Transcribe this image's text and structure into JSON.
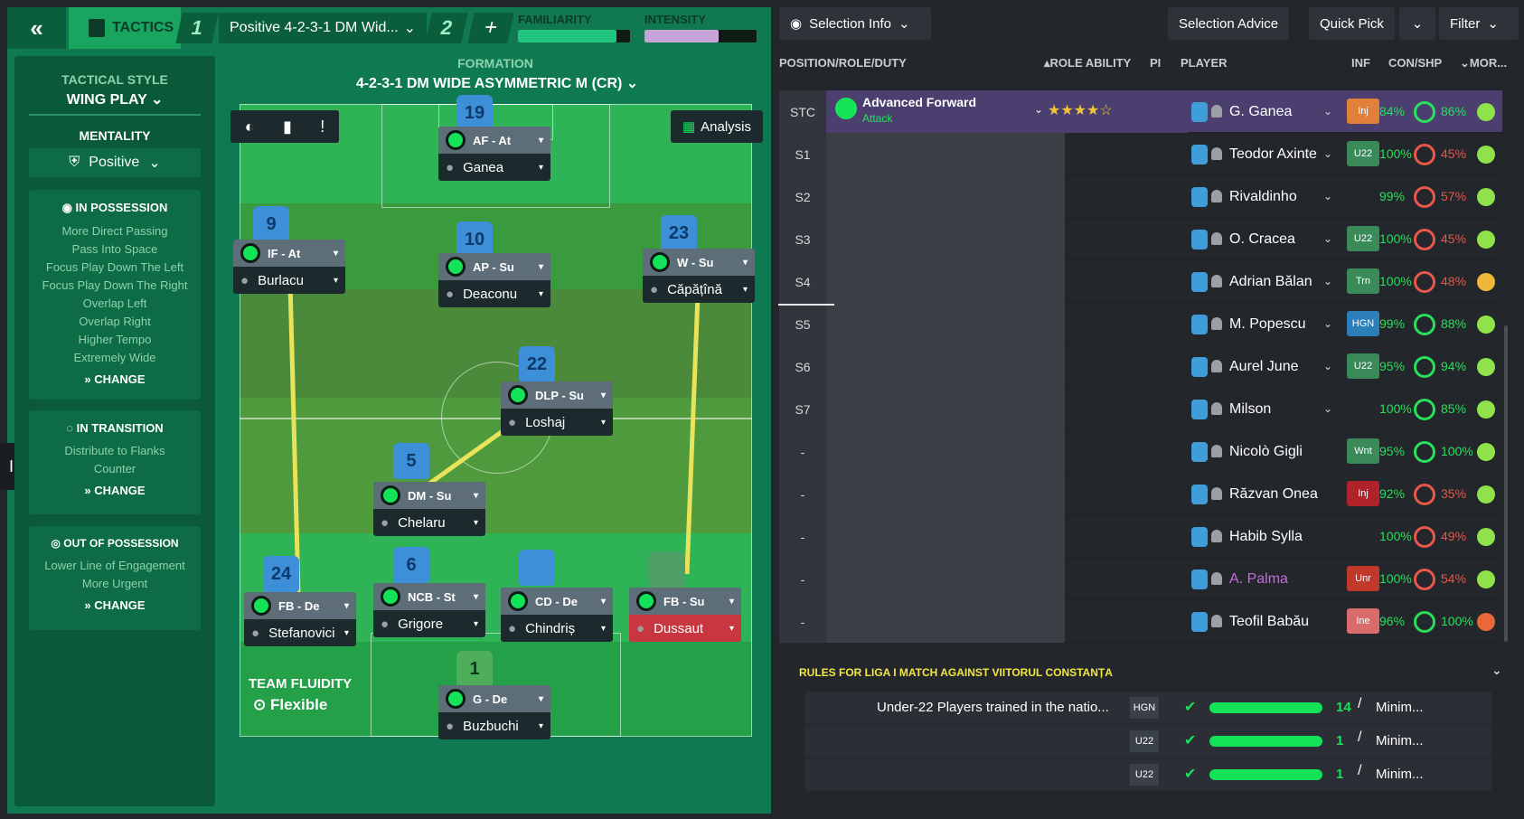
{
  "topbar": {
    "back": "«",
    "tactics_label": "TACTICS",
    "tactic1": "1",
    "tactic_name": "Positive 4-2-3-1 DM Wid...",
    "tactic2": "2",
    "plus": "+",
    "familiarity_label": "FAMILIARITY",
    "intensity_label": "INTENSITY",
    "familiarity": 0.88,
    "intensity": 0.66
  },
  "info_tab": "Info",
  "style": {
    "label": "TACTICAL STYLE",
    "value": "WING PLAY",
    "mentality_label": "MENTALITY",
    "mentality": "Positive",
    "in_possession": {
      "title": "IN POSSESSION",
      "items": [
        "More Direct Passing",
        "Pass Into Space",
        "Focus Play Down The Left",
        "Focus Play Down The Right",
        "Overlap Left",
        "Overlap Right",
        "Higher Tempo",
        "Extremely Wide"
      ],
      "change": "CHANGE"
    },
    "in_transition": {
      "title": "IN TRANSITION",
      "items": [
        "Distribute to Flanks",
        "Counter"
      ],
      "change": "CHANGE"
    },
    "out_possession": {
      "title": "OUT OF POSSESSION",
      "items": [
        "Lower Line of Engagement",
        "More Urgent"
      ],
      "change": "CHANGE"
    }
  },
  "formation": {
    "label": "FORMATION",
    "name": "4-2-3-1 DM WIDE ASYMMETRIC M (CR)",
    "analysis": "Analysis",
    "fluidity_label": "TEAM FLUIDITY",
    "fluidity": "Flexible"
  },
  "players_pitch": [
    {
      "num": "19",
      "role": "AF - At",
      "name": "Ganea"
    },
    {
      "num": "9",
      "role": "IF - At",
      "name": "Burlacu"
    },
    {
      "num": "10",
      "role": "AP - Su",
      "name": "Deaconu"
    },
    {
      "num": "23",
      "role": "W - Su",
      "name": "Căpățînă"
    },
    {
      "num": "22",
      "role": "DLP - Su",
      "name": "Loshaj"
    },
    {
      "num": "5",
      "role": "DM - Su",
      "name": "Chelaru"
    },
    {
      "num": "24",
      "role": "FB - De",
      "name": "Stefanovici"
    },
    {
      "num": "6",
      "role": "NCB - St",
      "name": "Grigore"
    },
    {
      "num": "",
      "role": "CD - De",
      "name": "Chindriș"
    },
    {
      "num": "",
      "role": "FB - Su",
      "name": "Dussaut"
    },
    {
      "num": "1",
      "role": "G - De",
      "name": "Buzbuchi"
    }
  ],
  "right": {
    "selection_info": "Selection Info",
    "selection_advice": "Selection Advice",
    "quick_pick": "Quick Pick",
    "filter": "Filter",
    "headers": {
      "pos": "POSITION/ROLE/DUTY",
      "role_ability": "ROLE ABILITY",
      "pi": "PI",
      "player": "PLAYER",
      "inf": "INF",
      "con": "CON/SHP",
      "more": "MOR..."
    },
    "selected_role": "Advanced Forward",
    "selected_duty": "Attack",
    "rows": [
      {
        "pos": "STC",
        "name": "G. Ganea",
        "badge": "Inj",
        "badgeColor": "#e0803a",
        "con": "84%",
        "shp": "86%",
        "shpColor": "#27e05b"
      },
      {
        "pos": "S1",
        "name": "Teodor Axinte",
        "badge": "U22",
        "badgeColor": "#3a8a5a",
        "con": "100%",
        "shp": "45%",
        "shpColor": "#e8574a"
      },
      {
        "pos": "S2",
        "name": "Rivaldinho",
        "badge": "",
        "badgeColor": "",
        "con": "99%",
        "shp": "57%",
        "shpColor": "#e8574a"
      },
      {
        "pos": "S3",
        "name": "O. Cracea",
        "badge": "U22",
        "badgeColor": "#3a8a5a",
        "con": "100%",
        "shp": "45%",
        "shpColor": "#e8574a"
      },
      {
        "pos": "S4",
        "name": "Adrian Bălan",
        "badge": "Trn",
        "badgeColor": "#3a8a5a",
        "con": "100%",
        "shp": "48%",
        "shpColor": "#e8574a"
      },
      {
        "pos": "S5",
        "name": "M. Popescu",
        "badge": "HGN",
        "badgeColor": "#2c7fb8",
        "con": "99%",
        "shp": "88%",
        "shpColor": "#27e05b"
      },
      {
        "pos": "S6",
        "name": "Aurel June",
        "badge": "U22",
        "badgeColor": "#3a8a5a",
        "con": "95%",
        "shp": "94%",
        "shpColor": "#27e05b"
      },
      {
        "pos": "S7",
        "name": "Milson",
        "badge": "",
        "badgeColor": "",
        "con": "100%",
        "shp": "85%",
        "shpColor": "#27e05b"
      },
      {
        "pos": "-",
        "name": "Nicolò Gigli",
        "badge": "Wnt",
        "badgeColor": "#3a8a5a",
        "con": "95%",
        "shp": "100%",
        "shpColor": "#27e05b"
      },
      {
        "pos": "-",
        "name": "Răzvan Onea",
        "badge": "Inj",
        "badgeColor": "#b0232a",
        "con": "92%",
        "shp": "35%",
        "shpColor": "#e8574a"
      },
      {
        "pos": "-",
        "name": "Habib Sylla",
        "badge": "",
        "badgeColor": "",
        "con": "100%",
        "shp": "49%",
        "shpColor": "#e8574a"
      },
      {
        "pos": "-",
        "name": "A. Palma",
        "badge": "Unr",
        "badgeColor": "#c0392b",
        "con": "100%",
        "shp": "54%",
        "shpColor": "#e8574a"
      },
      {
        "pos": "-",
        "name": "Teofil Babău",
        "badge": "Ine",
        "badgeColor": "#d96b6b",
        "con": "96%",
        "shp": "100%",
        "shpColor": "#27e05b"
      }
    ],
    "rules": {
      "title": "RULES FOR LIGA I MATCH AGAINST VIITORUL CONSTANȚA",
      "rows": [
        {
          "text": "Under-22 Players trained in the natio...",
          "tag": "HGN",
          "count": "14",
          "min": "Minim..."
        },
        {
          "text": "",
          "tag": "U22",
          "count": "1",
          "min": "Minim..."
        },
        {
          "text": "",
          "tag": "U22",
          "count": "1",
          "min": "Minim..."
        }
      ]
    }
  }
}
